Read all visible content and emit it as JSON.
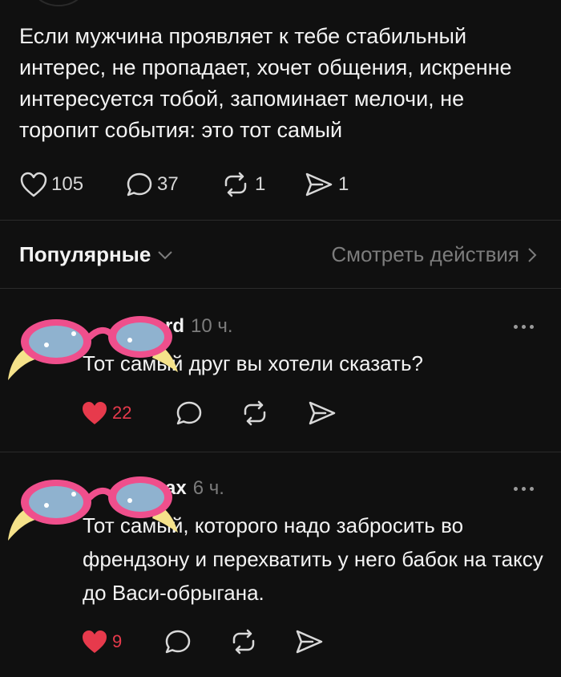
{
  "post": {
    "text": "Если мужчина проявляет к тебе стабильный интерес, не пропадает, хочет общения, искренне интересуется тобой, запоминает мелочи, не торопит события: это тот самый",
    "likes": "105",
    "replies": "37",
    "reposts": "1",
    "shares": "1"
  },
  "sort": {
    "label": "Популярные",
    "view_activity": "Смотреть действия"
  },
  "comments": [
    {
      "name_visible": "rd",
      "time": "10 ч.",
      "text": "Тот самый друг вы хотели сказать?",
      "likes": "22"
    },
    {
      "name_visible": "ах",
      "time": "6 ч.",
      "text": "Тот самый, которого надо забросить во френдзону и перехватить у него бабок на таксу до Васи-обрыгана.",
      "likes": "9"
    }
  ],
  "colors": {
    "background": "#101010",
    "like_red": "#e73a4c",
    "goggles_pink": "#ef4f8c",
    "goggles_lens": "#8fb2cf",
    "strap_yellow": "#f5e28a"
  },
  "icons": [
    "heart-icon",
    "comment-icon",
    "repost-icon",
    "share-icon",
    "chevron-down-icon",
    "chevron-right-icon",
    "more-icon",
    "goggles-sticker"
  ]
}
